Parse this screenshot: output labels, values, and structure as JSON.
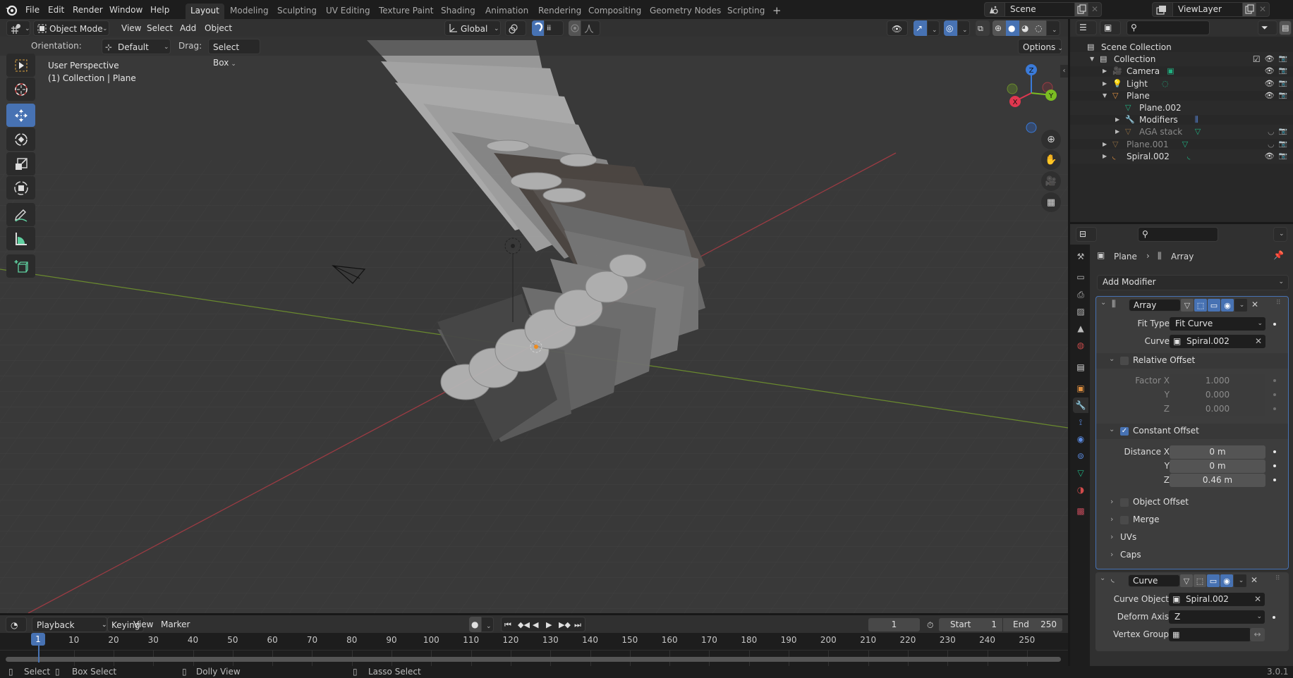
{
  "topbar": {
    "menus": [
      "File",
      "Edit",
      "Render",
      "Window",
      "Help"
    ],
    "workspaces": [
      "Layout",
      "Modeling",
      "Sculpting",
      "UV Editing",
      "Texture Paint",
      "Shading",
      "Animation",
      "Rendering",
      "Compositing",
      "Geometry Nodes",
      "Scripting"
    ],
    "active_workspace": "Layout",
    "add_workspace": "+",
    "scene": "Scene",
    "view_layer": "ViewLayer"
  },
  "viewport": {
    "mode": "Object Mode",
    "menus": [
      "View",
      "Select",
      "Add",
      "Object"
    ],
    "orientation_label": "Orientation:",
    "orientation_value": "Default",
    "drag_label": "Drag:",
    "drag_value": "Select Box",
    "transform_orientation": "Global",
    "options_label": "Options",
    "overlay_title": "User Perspective",
    "overlay_subtitle": "(1) Collection | Plane",
    "gizmo_axes": [
      "X",
      "Y",
      "Z"
    ],
    "tools": [
      "select-box",
      "cursor",
      "move",
      "rotate",
      "scale",
      "transform",
      "annotate",
      "measure",
      "add-cube"
    ],
    "active_tool": "move",
    "nav": [
      "zoom",
      "pan",
      "camera",
      "ortho-grid"
    ]
  },
  "outliner": {
    "search_placeholder": "",
    "rows": [
      {
        "label": "Scene Collection",
        "level": 0,
        "icon": "collection",
        "expanded": null,
        "dim": false
      },
      {
        "label": "Collection",
        "level": 1,
        "icon": "collection",
        "expanded": true,
        "dim": false
      },
      {
        "label": "Camera",
        "level": 2,
        "icon": "camera",
        "expanded": false,
        "dim": false
      },
      {
        "label": "Light",
        "level": 2,
        "icon": "light",
        "expanded": false,
        "dim": false
      },
      {
        "label": "Plane",
        "level": 2,
        "icon": "mesh",
        "expanded": true,
        "dim": false
      },
      {
        "label": "Plane.002",
        "level": 3,
        "icon": "mesh-data",
        "expanded": null,
        "dim": false
      },
      {
        "label": "Modifiers",
        "level": 3,
        "icon": "wrench",
        "expanded": false,
        "dim": false
      },
      {
        "label": "AGA stack",
        "level": 3,
        "icon": "mesh",
        "expanded": false,
        "dim": true
      },
      {
        "label": "Plane.001",
        "level": 2,
        "icon": "mesh",
        "expanded": false,
        "dim": true
      },
      {
        "label": "Spiral.002",
        "level": 2,
        "icon": "curve",
        "expanded": false,
        "dim": false
      }
    ]
  },
  "properties": {
    "breadcrumb_object": "Plane",
    "breadcrumb_modifier": "Array",
    "add_modifier": "Add Modifier",
    "array": {
      "name": "Array",
      "fit_type_label": "Fit Type",
      "fit_type": "Fit Curve",
      "curve_label": "Curve",
      "curve": "Spiral.002",
      "relative_offset": {
        "label": "Relative Offset",
        "enabled": false,
        "factor_x_label": "Factor X",
        "y_label": "Y",
        "z_label": "Z",
        "x": "1.000",
        "y": "0.000",
        "z": "0.000"
      },
      "constant_offset": {
        "label": "Constant Offset",
        "enabled": true,
        "distance_x_label": "Distance X",
        "y_label": "Y",
        "z_label": "Z",
        "x": "0 m",
        "y": "0 m",
        "z": "0.46 m"
      },
      "object_offset": {
        "label": "Object Offset",
        "enabled": false
      },
      "merge": {
        "label": "Merge",
        "enabled": false
      },
      "uvs_label": "UVs",
      "caps_label": "Caps"
    },
    "curve": {
      "name": "Curve",
      "curve_object_label": "Curve Object",
      "curve_object": "Spiral.002",
      "deform_axis_label": "Deform Axis",
      "deform_axis": "Z",
      "vertex_group_label": "Vertex Group",
      "vertex_group": ""
    }
  },
  "timeline": {
    "menus": [
      "Playback",
      "Keying",
      "View",
      "Marker"
    ],
    "current_frame": "1",
    "start_label": "Start",
    "start": "1",
    "end_label": "End",
    "end": "250",
    "ticks": [
      "10",
      "20",
      "30",
      "40",
      "50",
      "60",
      "70",
      "80",
      "90",
      "100",
      "110",
      "120",
      "130",
      "140",
      "150",
      "160",
      "170",
      "180",
      "190",
      "200",
      "210",
      "220",
      "230",
      "240",
      "250"
    ],
    "playhead": "1"
  },
  "statusbar": {
    "select": "Select",
    "box_select": "Box Select",
    "dolly_view": "Dolly View",
    "lasso_select": "Lasso Select",
    "version": "3.0.1"
  }
}
